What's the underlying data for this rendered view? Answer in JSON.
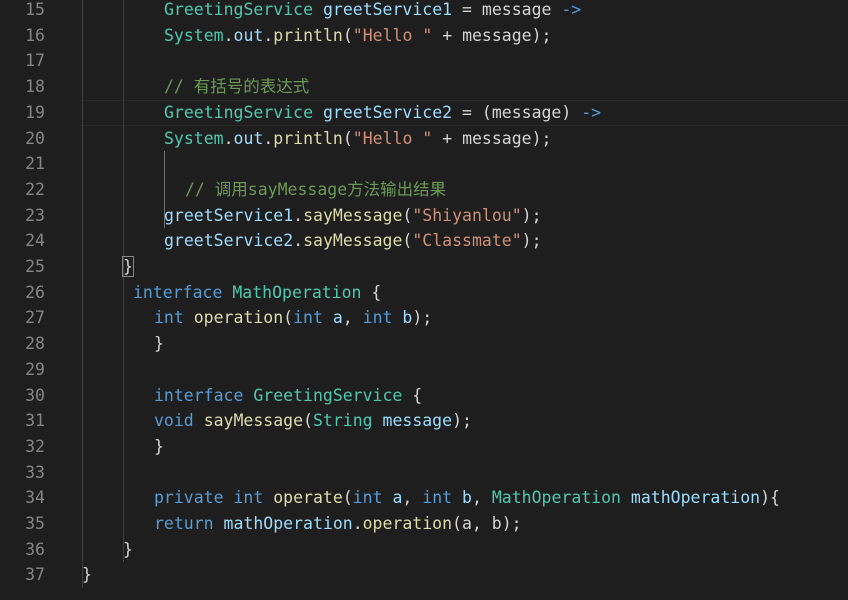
{
  "line_numbers": [
    "15",
    "16",
    "17",
    "18",
    "19",
    "20",
    "21",
    "22",
    "23",
    "24",
    "25",
    "26",
    "27",
    "28",
    "29",
    "30",
    "31",
    "32",
    "33",
    "34",
    "35",
    "36",
    "37"
  ],
  "lines": [
    {
      "indent": 164,
      "tokens": [
        [
          "ty",
          "GreetingService"
        ],
        [
          "pl",
          " "
        ],
        [
          "var",
          "greetService1"
        ],
        [
          "pl",
          " = message "
        ],
        [
          "kw",
          "->"
        ]
      ]
    },
    {
      "indent": 164,
      "tokens": [
        [
          "ty",
          "System"
        ],
        [
          "pl",
          "."
        ],
        [
          "var",
          "out"
        ],
        [
          "pl",
          "."
        ],
        [
          "fn",
          "println"
        ],
        [
          "pl",
          "("
        ],
        [
          "str",
          "\"Hello \""
        ],
        [
          "pl",
          " + message);"
        ]
      ]
    },
    {
      "indent": 164,
      "tokens": []
    },
    {
      "indent": 164,
      "tokens": [
        [
          "cm",
          "// 有括号的表达式"
        ]
      ]
    },
    {
      "indent": 164,
      "tokens": [
        [
          "ty",
          "GreetingService"
        ],
        [
          "pl",
          " "
        ],
        [
          "var",
          "greetService2"
        ],
        [
          "pl",
          " = (message) "
        ],
        [
          "kw",
          "->"
        ]
      ]
    },
    {
      "indent": 164,
      "tokens": [
        [
          "ty",
          "System"
        ],
        [
          "pl",
          "."
        ],
        [
          "var",
          "out"
        ],
        [
          "pl",
          "."
        ],
        [
          "fn",
          "println"
        ],
        [
          "pl",
          "("
        ],
        [
          "str",
          "\"Hello \""
        ],
        [
          "pl",
          " + message);"
        ]
      ]
    },
    {
      "indent": 164,
      "tokens": []
    },
    {
      "indent": 185,
      "tokens": [
        [
          "cm",
          "// 调用sayMessage方法输出结果"
        ]
      ]
    },
    {
      "indent": 164,
      "tokens": [
        [
          "var",
          "greetService1"
        ],
        [
          "pl",
          "."
        ],
        [
          "fn",
          "sayMessage"
        ],
        [
          "pl",
          "("
        ],
        [
          "str",
          "\"Shiyanlou\""
        ],
        [
          "pl",
          ");"
        ]
      ]
    },
    {
      "indent": 164,
      "tokens": [
        [
          "var",
          "greetService2"
        ],
        [
          "pl",
          "."
        ],
        [
          "fn",
          "sayMessage"
        ],
        [
          "pl",
          "("
        ],
        [
          "str",
          "\"Classmate\""
        ],
        [
          "pl",
          ");"
        ]
      ]
    },
    {
      "indent": 123,
      "tokens": [
        [
          "pl",
          "}"
        ]
      ]
    },
    {
      "indent": 133,
      "tokens": [
        [
          "kw",
          "interface"
        ],
        [
          "pl",
          " "
        ],
        [
          "ty",
          "MathOperation"
        ],
        [
          "pl",
          " {"
        ]
      ]
    },
    {
      "indent": 154,
      "tokens": [
        [
          "kw",
          "int"
        ],
        [
          "pl",
          " "
        ],
        [
          "fn",
          "operation"
        ],
        [
          "pl",
          "("
        ],
        [
          "kw",
          "int"
        ],
        [
          "pl",
          " "
        ],
        [
          "var",
          "a"
        ],
        [
          "pl",
          ", "
        ],
        [
          "kw",
          "int"
        ],
        [
          "pl",
          " "
        ],
        [
          "var",
          "b"
        ],
        [
          "pl",
          ");"
        ]
      ]
    },
    {
      "indent": 154,
      "tokens": [
        [
          "pl",
          "}"
        ]
      ]
    },
    {
      "indent": 154,
      "tokens": []
    },
    {
      "indent": 154,
      "tokens": [
        [
          "kw",
          "interface"
        ],
        [
          "pl",
          " "
        ],
        [
          "ty",
          "GreetingService"
        ],
        [
          "pl",
          " {"
        ]
      ]
    },
    {
      "indent": 154,
      "tokens": [
        [
          "kw",
          "void"
        ],
        [
          "pl",
          " "
        ],
        [
          "fn",
          "sayMessage"
        ],
        [
          "pl",
          "("
        ],
        [
          "ty",
          "String"
        ],
        [
          "pl",
          " "
        ],
        [
          "var",
          "message"
        ],
        [
          "pl",
          ");"
        ]
      ]
    },
    {
      "indent": 154,
      "tokens": [
        [
          "pl",
          "}"
        ]
      ]
    },
    {
      "indent": 154,
      "tokens": []
    },
    {
      "indent": 154,
      "tokens": [
        [
          "kw",
          "private"
        ],
        [
          "pl",
          " "
        ],
        [
          "kw",
          "int"
        ],
        [
          "pl",
          " "
        ],
        [
          "fn",
          "operate"
        ],
        [
          "pl",
          "("
        ],
        [
          "kw",
          "int"
        ],
        [
          "pl",
          " "
        ],
        [
          "var",
          "a"
        ],
        [
          "pl",
          ", "
        ],
        [
          "kw",
          "int"
        ],
        [
          "pl",
          " "
        ],
        [
          "var",
          "b"
        ],
        [
          "pl",
          ", "
        ],
        [
          "ty",
          "MathOperation"
        ],
        [
          "pl",
          " "
        ],
        [
          "var",
          "mathOperation"
        ],
        [
          "pl",
          "){"
        ]
      ]
    },
    {
      "indent": 154,
      "tokens": [
        [
          "kw",
          "return"
        ],
        [
          "pl",
          " "
        ],
        [
          "var",
          "mathOperation"
        ],
        [
          "pl",
          "."
        ],
        [
          "fn",
          "operation"
        ],
        [
          "pl",
          "(a, b);"
        ]
      ]
    },
    {
      "indent": 123,
      "tokens": [
        [
          "pl",
          "}"
        ]
      ]
    },
    {
      "indent": 82,
      "tokens": [
        [
          "pl",
          "}"
        ]
      ]
    }
  ]
}
